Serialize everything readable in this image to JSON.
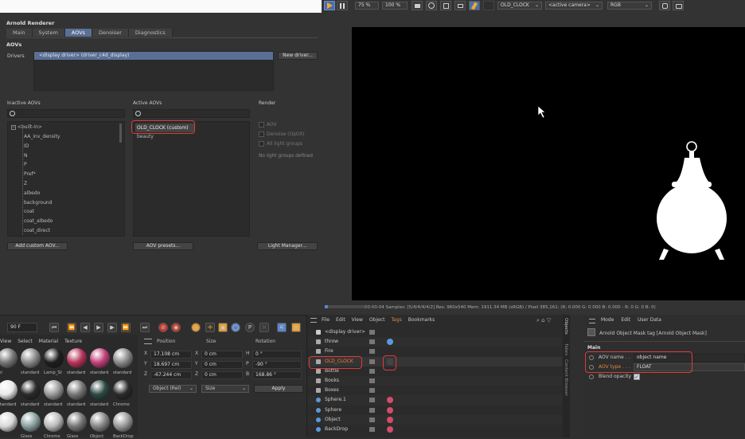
{
  "arnold_renderer": {
    "title": "Arnold Renderer",
    "tabs": [
      {
        "label": "Main",
        "active": false
      },
      {
        "label": "System",
        "active": false
      },
      {
        "label": "AOVs",
        "active": true
      },
      {
        "label": "Denoiser",
        "active": false
      },
      {
        "label": "Diagnostics",
        "active": false
      }
    ],
    "section_title": "AOVs",
    "drivers_label": "Drivers",
    "driver_entry": "<display driver> (driver_c4d_display)",
    "new_driver_button": "New driver...",
    "inactive_header": "Inactive AOVs",
    "active_header": "Active AOVs",
    "render_header": "Render",
    "built_in_label": "<built-in>",
    "inactive_items": [
      "AA_inv_density",
      "ID",
      "N",
      "P",
      "Pref*",
      "Z",
      "albedo",
      "background",
      "coat",
      "coat_albedo",
      "coat_direct"
    ],
    "active_items": [
      "OLD_CLOCK (custom)",
      "beauty"
    ],
    "render_options": [
      "AOV",
      "Denoise (OptiX)",
      "All light groups"
    ],
    "no_light_groups": "No light groups defined",
    "add_custom_button": "Add custom AOV...",
    "aov_presets_button": "AOV presets...",
    "light_manager_button": "Light Manager..."
  },
  "viewer": {
    "zoom": "75 %",
    "scale": "100 %",
    "aov_select": "OLD_CLOCK",
    "camera_select": "<active camera>",
    "channel_select": "RGB",
    "status": "00:00:04  Samples: [5/4/4/4/4/2]  Res: 960x540  Mem: 1911.34 MB  (sRGB) / Pixel 385,161: (R: 0.000 G: 0.000 B: 0.000 - R: 0 G: 0 B: 0)",
    "accent": "#5b86c9",
    "silhouette_color": "#ffffff"
  },
  "timeline": {
    "frame": "90 F"
  },
  "material_manager": {
    "menu": [
      "View",
      "Select",
      "Material",
      "Texture"
    ],
    "row1": [
      "wl",
      "standard",
      "Lamp_St",
      "standard",
      "standard",
      "standard"
    ],
    "row2": [
      "standard",
      "standard",
      "standard",
      "standard",
      "standard",
      "Chrome"
    ],
    "row3": [
      "",
      "Glass",
      "Chrome",
      "Glass",
      "Object",
      "BackDrop"
    ]
  },
  "coordinates": {
    "position_header": "Position",
    "size_header": "Size",
    "rotation_header": "Rotation",
    "rows": [
      {
        "axis": "X",
        "pos": "17.108 cm",
        "saxis": "X",
        "size": "0 cm",
        "raxis": "H",
        "rot": "0 °"
      },
      {
        "axis": "Y",
        "pos": "18.697 cm",
        "saxis": "Y",
        "size": "0 cm",
        "raxis": "P",
        "rot": "-90 °"
      },
      {
        "axis": "Z",
        "pos": "-67.244 cm",
        "saxis": "Z",
        "size": "0 cm",
        "raxis": "B",
        "rot": "168.86 °"
      }
    ],
    "mode_select": "Object (Rel)",
    "size_select": "Size",
    "apply_button": "Apply"
  },
  "object_manager": {
    "menu": [
      "File",
      "Edit",
      "View",
      "Object",
      "Tags",
      "Bookmarks"
    ],
    "objects": [
      "<display driver>",
      "throw",
      "Fire",
      "OLD_CLOCK",
      "Bottle",
      "Books",
      "Boxes",
      "Sphere.1",
      "Sphere",
      "Object",
      "BackDrop"
    ],
    "side_tabs": [
      "Objects",
      "Takes",
      "Content Browser"
    ]
  },
  "attribute_manager": {
    "menu": [
      "Mode",
      "Edit",
      "User Data"
    ],
    "tag_title": "Arnold Object Mask tag [Arnold Object Mask]",
    "section": "Main",
    "aov_name_label": "AOV name . .",
    "aov_name_value": "object name",
    "aov_type_label": "AOV type . . .",
    "aov_type_value": "FLOAT",
    "blend_label": "Blend opacity"
  }
}
